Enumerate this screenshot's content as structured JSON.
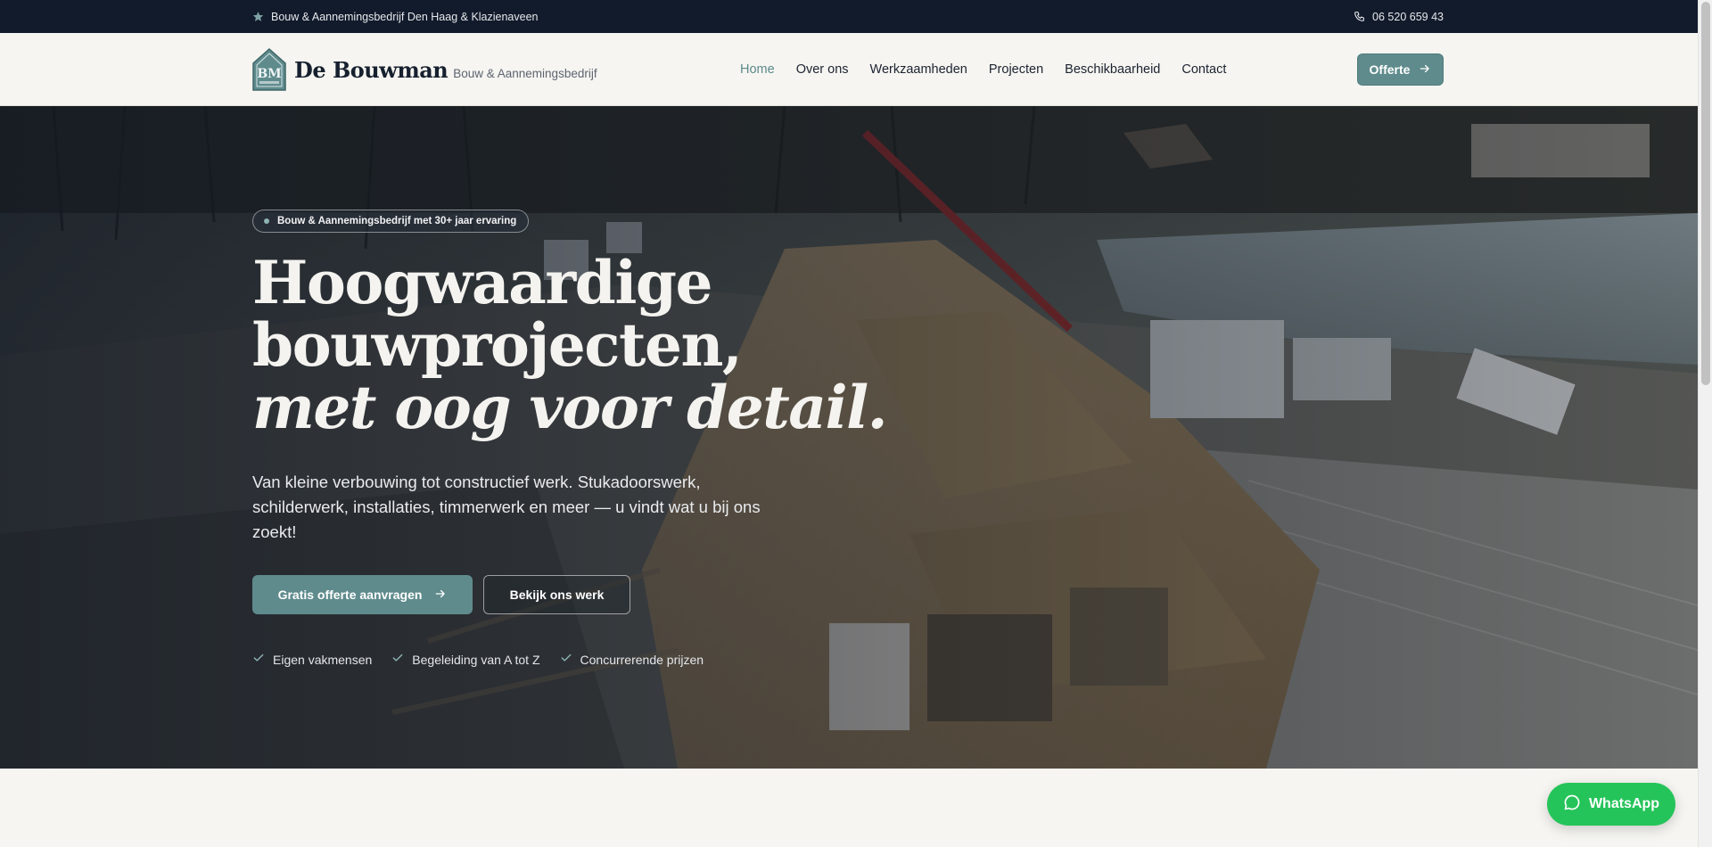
{
  "topbar": {
    "tagline": "Bouw & Aannemingsbedrijf Den Haag & Klazienaveen",
    "phone": "06 520 659 43",
    "star_icon": "star-icon",
    "phone_icon": "phone-icon"
  },
  "header": {
    "brand_name": "De Bouwman",
    "brand_sub": "Bouw & Aannemingsbedrijf",
    "logo_letters": "BM",
    "nav": [
      {
        "label": "Home",
        "active": true
      },
      {
        "label": "Over ons",
        "active": false
      },
      {
        "label": "Werkzaamheden",
        "active": false
      },
      {
        "label": "Projecten",
        "active": false
      },
      {
        "label": "Beschikbaarheid",
        "active": false
      },
      {
        "label": "Contact",
        "active": false
      }
    ],
    "cta_label": "Offerte"
  },
  "hero": {
    "badge": "Bouw & Aannemingsbedrijf met 30+ jaar ervaring",
    "headline_line1": "Hoogwaardige",
    "headline_line2": "bouwprojecten,",
    "headline_line3": "met oog voor detail.",
    "lead": "Van kleine verbouwing tot constructief werk. Stukadoorswerk, schilderwerk, installaties, timmerwerk en meer — u vindt wat u bij ons zoekt!",
    "primary_cta": "Gratis offerte aanvragen",
    "secondary_cta": "Bekijk ons werk",
    "checks": [
      "Eigen vakmensen",
      "Begeleiding van A tot Z",
      "Concurrerende prijzen"
    ]
  },
  "whatsapp": {
    "label": "WhatsApp"
  },
  "colors": {
    "topbar_bg": "#121b2b",
    "accent": "#5f8b8d",
    "page_bg": "#f6f5f1",
    "whatsapp_green": "#25c45a"
  }
}
